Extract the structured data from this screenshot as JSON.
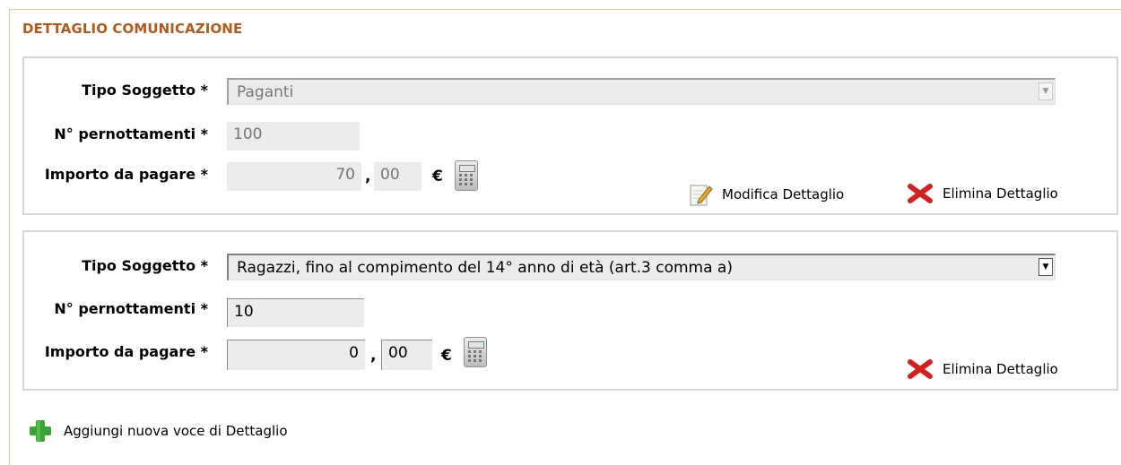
{
  "section": {
    "title": "DETTAGLIO COMUNICAZIONE"
  },
  "details": [
    {
      "tipo_label": "Tipo Soggetto *",
      "tipo_value": "Paganti",
      "pernott_label": "N° pernottamenti *",
      "pernott_value": "100",
      "importo_label": "Importo da pagare *",
      "importo_int": "70",
      "importo_dec": "00",
      "comma": ",",
      "currency": "€",
      "modify_label": "Modifica Dettaglio",
      "delete_label": "Elimina Dettaglio"
    },
    {
      "tipo_label": "Tipo Soggetto *",
      "tipo_value": "Ragazzi, fino al compimento del 14° anno di età (art.3 comma a)",
      "pernott_label": "N° pernottamenti *",
      "pernott_value": "10",
      "importo_label": "Importo da pagare *",
      "importo_int": "0",
      "importo_dec": "00",
      "comma": ",",
      "currency": "€",
      "delete_label": "Elimina Dettaglio"
    }
  ],
  "add_label": "Aggiungi nuova voce di Dettaglio",
  "icons": {
    "delete": "red-x-icon",
    "modify": "pencil-icon",
    "add": "green-plus-icon",
    "calculator": "calculator-icon"
  },
  "colors": {
    "title": "#b05a1e",
    "delete": "#d42020",
    "add": "#3aa335"
  }
}
